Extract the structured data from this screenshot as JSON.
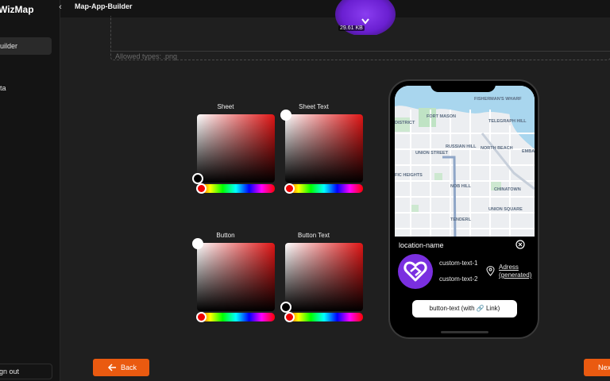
{
  "app": {
    "brand": "WizMap"
  },
  "sidebar": {
    "items": [
      {
        "label": "uilder",
        "active": true
      },
      {
        "label": "ta",
        "active": false
      }
    ],
    "signout": "gn out"
  },
  "header": {
    "title": "Map-App-Builder"
  },
  "upload": {
    "allowed": "Allowed types: .png",
    "file_size": "29.61 KB"
  },
  "pickers": [
    {
      "label": "Sheet",
      "hue": "red",
      "handle": "bottom-left"
    },
    {
      "label": "Sheet Text",
      "hue": "red",
      "handle": "top-left"
    },
    {
      "label": "Button",
      "hue": "red",
      "handle": "top-left"
    },
    {
      "label": "Button Text",
      "hue": "red",
      "handle": "bottom-left"
    }
  ],
  "preview": {
    "location_name": "location-name",
    "custom_text_1": "custom-text-1",
    "custom_text_2": "custom-text-2",
    "address_line1": "Adress",
    "address_line2": "(generated)",
    "button_text": "button-text (with 🔗 Link)",
    "map_labels": [
      "FISHERMAN'S WHARF",
      "FORT MASON",
      "DISTRICT",
      "TELEGRAPH HILL",
      "NORTH BEACH",
      "RUSSIAN HILL",
      "EMBA",
      "UNION STREET",
      "CHINATOWN",
      "FIC HEIGHTS",
      "NOB HILL",
      "UNION SQUARE",
      "TENDERL"
    ]
  },
  "footer": {
    "back": "Back",
    "next": "Nex"
  },
  "colors": {
    "accent": "#ea5a10",
    "logo": "#7a2fe0",
    "background": "#1f1f1f"
  }
}
